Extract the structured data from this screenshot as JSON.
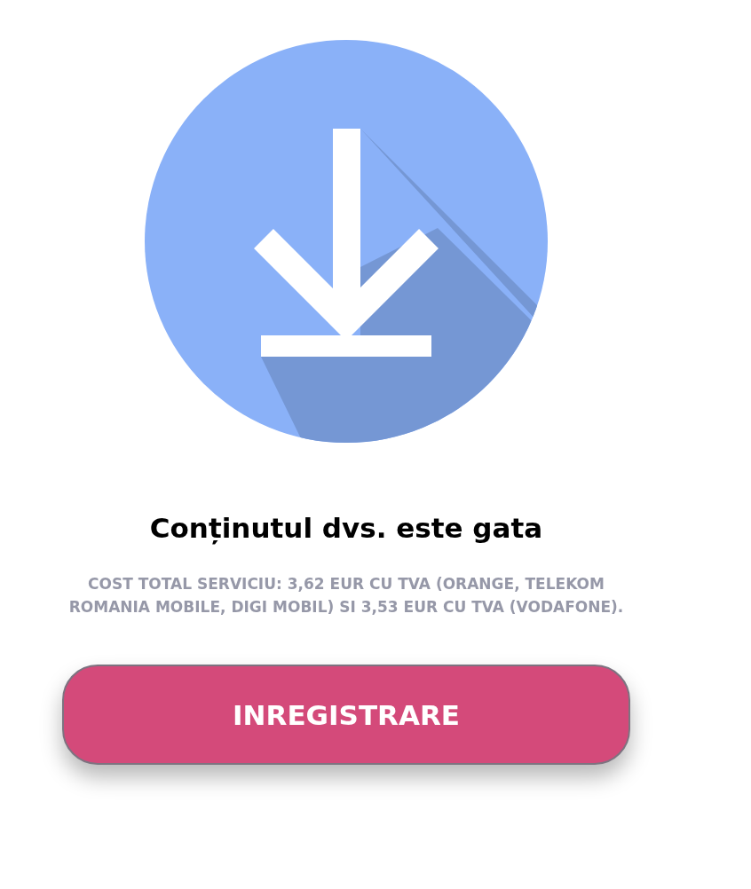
{
  "title": "Conținutul dvs. este gata",
  "notice": "COST TOTAL SERVICIU: 3,62 EUR CU TVA (ORANGE, TELEKOM ROMANIA MOBILE, DIGI MOBIL) SI 3,53 EUR CU TVA (VODAFONE).",
  "button": {
    "label": "INREGISTRARE"
  }
}
